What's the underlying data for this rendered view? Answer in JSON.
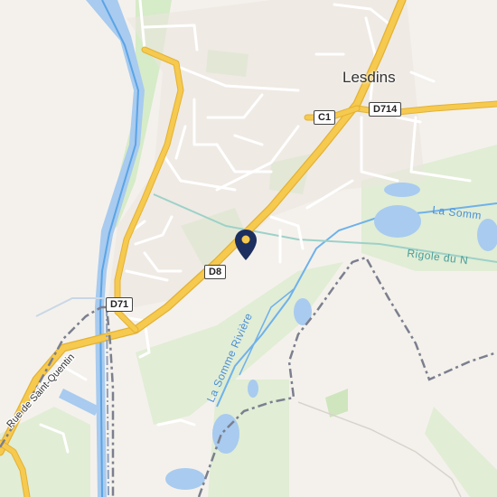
{
  "map": {
    "place_name": "Lesdins",
    "road_labels": {
      "d714": "D714",
      "c1": "C1",
      "d8": "D8",
      "d71": "D71"
    },
    "street_label": "Rue de Saint-Quentin",
    "water_labels": {
      "somme_riviere": "La Somme Rivière",
      "somme_east": "La Somm",
      "rigole": "Rigole du N"
    },
    "colors": {
      "background": "#f4f1ec",
      "road_major": "#f6c94f",
      "road_minor": "#ffffff",
      "water": "#a8cbef",
      "canal": "#5aa4e6",
      "green": "#d6ebc8",
      "boundary": "#7b7f8e",
      "marker": "#1c2f5e"
    }
  }
}
